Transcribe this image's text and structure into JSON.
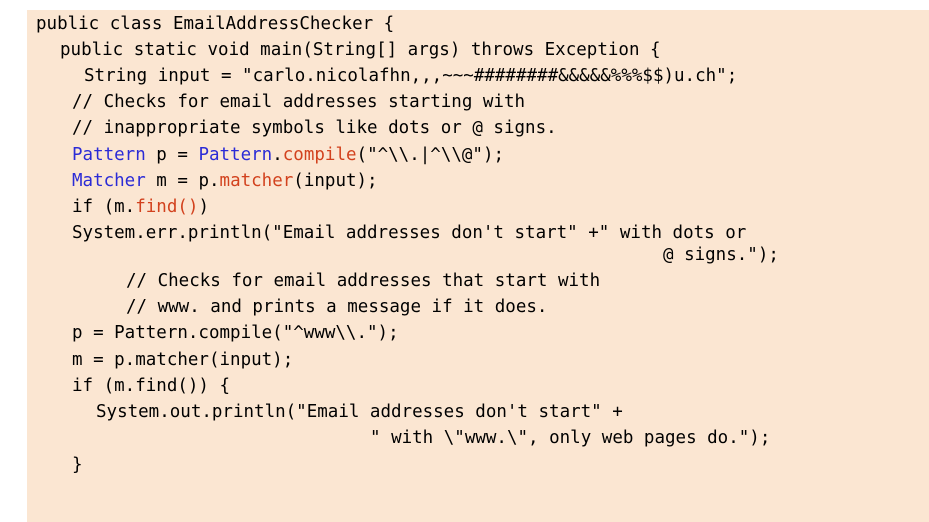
{
  "code": {
    "line1": "public class EmailAddressChecker {",
    "line2": "public static void main(String[] args) throws Exception {",
    "line3": "String input = \"carlo.nicolafhn,,,~~~########&&&&&%%%$$)u.ch\";",
    "line4": "// Checks for email addresses starting with",
    "line5": "// inappropriate symbols like dots or @ signs.",
    "line6": {
      "type1": "Pattern",
      "mid": " p = ",
      "type2": "Pattern",
      "dot": ".",
      "method": "compile",
      "rest": "(\"^\\\\.|^\\\\@\");"
    },
    "line7": {
      "type": "Matcher",
      "mid": " m = p.",
      "method": "matcher",
      "rest": "(input);"
    },
    "line8": {
      "pre": "if (m.",
      "method": "find()",
      "rest": ")"
    },
    "line9": "System.err.println(\"Email addresses don't start\" +\" with dots or",
    "line10": "@ signs.\");",
    "line11": "// Checks for email addresses that start with",
    "line12": "// www. and prints a message if it does.",
    "line13": "p = Pattern.compile(\"^www\\\\.\");",
    "line14": "m = p.matcher(input);",
    "line15": "if (m.find()) {",
    "line16": "System.out.println(\"Email addresses don't start\" +",
    "line17": "\" with \\\"www.\\\", only web pages do.\");",
    "line18": "}"
  },
  "colors": {
    "background": "#fbe6d2",
    "type_highlight": "#2b2bd6",
    "method_highlight": "#d2421e"
  }
}
